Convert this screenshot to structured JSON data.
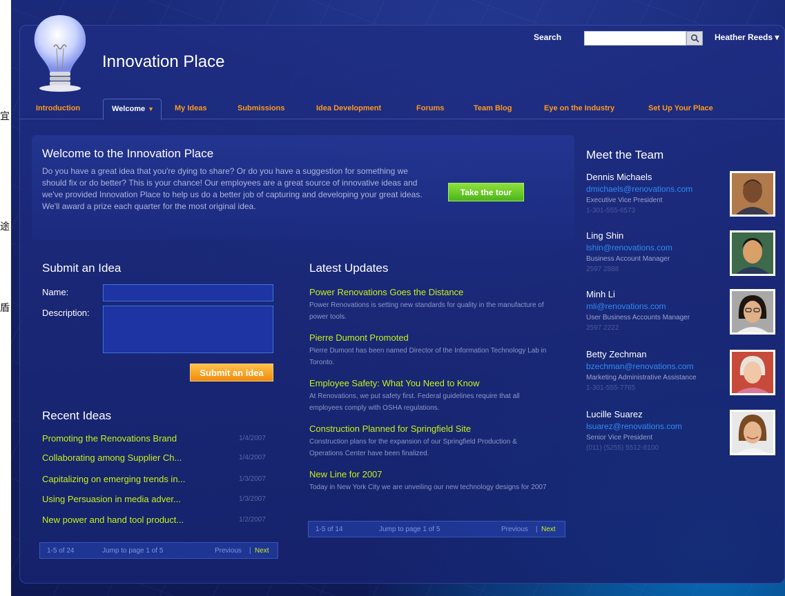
{
  "side_glyphs": [
    "宜",
    "途",
    "盾"
  ],
  "app": {
    "title": "Innovation Place"
  },
  "search": {
    "label": "Search",
    "placeholder": ""
  },
  "user": {
    "name": "Heather Reeds ▾"
  },
  "nav": {
    "items": [
      {
        "label": "Introduction"
      },
      {
        "label": "Welcome",
        "active": true
      },
      {
        "label": "My Ideas"
      },
      {
        "label": "Submissions"
      },
      {
        "label": "Idea Development"
      },
      {
        "label": "Forums"
      },
      {
        "label": "Team Blog"
      },
      {
        "label": "Eye on the Industry"
      },
      {
        "label": "Set Up Your Place"
      }
    ]
  },
  "welcome": {
    "title": "Welcome to the Innovation Place",
    "text": "Do you have a great idea that you're dying to share? Or do you have a  suggestion for something we should fix or do better? This is your chance! Our employees are a great source of innovative ideas and we've provided Innovation Place to help us do a better job of capturing and developing your great ideas. We'll award a prize each quarter for the most original idea.",
    "tour_button": "Take the tour"
  },
  "submit": {
    "title": "Submit an Idea",
    "name_label": "Name:",
    "description_label": "Description:",
    "name_value": "",
    "description_value": "",
    "button": "Submit an idea"
  },
  "recent": {
    "title": "Recent Ideas",
    "items": [
      {
        "title": "Promoting the Renovations Brand",
        "date": "1/4/2007"
      },
      {
        "title": "Collaborating among Supplier Ch...",
        "date": "1/4/2007"
      },
      {
        "title": "Capitalizing on emerging trends in...",
        "date": "1/3/2007"
      },
      {
        "title": "Using Persuasion in media adver...",
        "date": "1/3/2007"
      },
      {
        "title": "New power and hand tool product...",
        "date": "1/2/2007"
      }
    ],
    "pager": {
      "range": "1-5 of 24",
      "jump": "Jump to page   1   of 5",
      "previous": "Previous",
      "sep": "|",
      "next": "Next"
    }
  },
  "updates": {
    "title": "Latest Updates",
    "items": [
      {
        "heading": "Power Renovations Goes the Distance",
        "body": "Power Renovations is setting new standards for quality in the manufacture of power tools."
      },
      {
        "heading": "Pierre Dumont  Promoted",
        "body": "Pierre Dumont has been named Director of the Information Technology Lab in Toronto."
      },
      {
        "heading": "Employee Safety:  What You Need to Know",
        "body": "At Renovations, we put safety first. Federal guidelines require that all employees comply with OSHA regulations."
      },
      {
        "heading": "Construction Planned for Springfield Site",
        "body": "Construction plans for the expansion of our Springfield Production & Operations Center have been finalized."
      },
      {
        "heading": "New Line for 2007",
        "body": "Today in New York City we are unveiling our new technology designs for 2007"
      }
    ],
    "pager": {
      "range": "1-5 of 14",
      "jump": "Jump to page   1   of 5",
      "previous": "Previous",
      "sep": "|",
      "next": "Next"
    }
  },
  "team": {
    "title": "Meet the Team",
    "members": [
      {
        "name": "Dennis Michaels",
        "email": "dmichaels@renovations.com",
        "role": "Executive Vice President",
        "phone": "1-301-555-6573",
        "skin": "#7a4a2c",
        "hair": "#3a2a22",
        "bg": "#b07a4a"
      },
      {
        "name": "Ling Shin",
        "email": "lshin@renovations.com",
        "role": "Business Account Manager",
        "phone": "2597 2888",
        "skin": "#d9a06a",
        "hair": "#141414",
        "bg": "#3c6a4a"
      },
      {
        "name": "Minh Li",
        "email": "mli@renovations.com",
        "role": "User Business Accounts Manager",
        "phone": "2597 2222",
        "skin": "#e0b088",
        "hair": "#1e1410",
        "bg": "#a8a8a8"
      },
      {
        "name": "Betty Zechman",
        "email": "bzechman@renovations.com",
        "role": "Marketing Administrative Assistance",
        "phone": "1-301-555-7765",
        "skin": "#f0c8a8",
        "hair": "#e8e4dc",
        "bg": "#c84a3a"
      },
      {
        "name": "Lucille Suarez",
        "email": "lsuarez@renovations.com",
        "role": "Senior Vice President",
        "phone": "(011) (5255) 5512-8100",
        "skin": "#e6b68e",
        "hair": "#7a4a22",
        "bg": "#e8e8e8"
      }
    ]
  }
}
